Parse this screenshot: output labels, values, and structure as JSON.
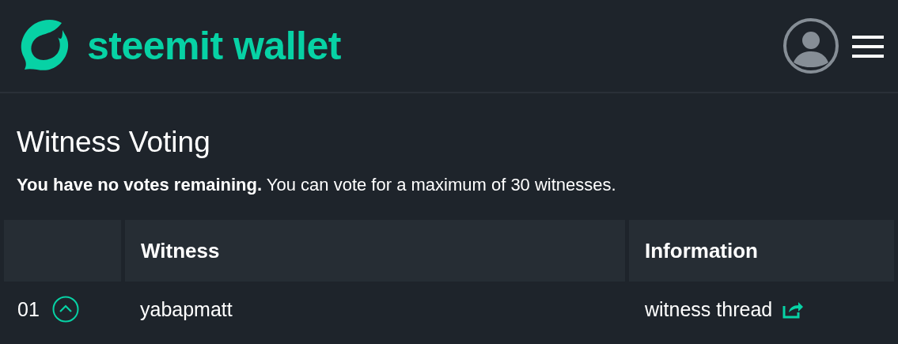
{
  "header": {
    "brand": "steemit wallet"
  },
  "title": "Witness Voting",
  "notice": "**You have no votes remaining.** You can vote for a maximum of 30 witnesses.",
  "table": {
    "columns": [
      "Witness",
      "Information"
    ],
    "rows": [
      {
        "rank": "01",
        "witness": "yabapmatt",
        "info": "witness thread"
      }
    ]
  }
}
